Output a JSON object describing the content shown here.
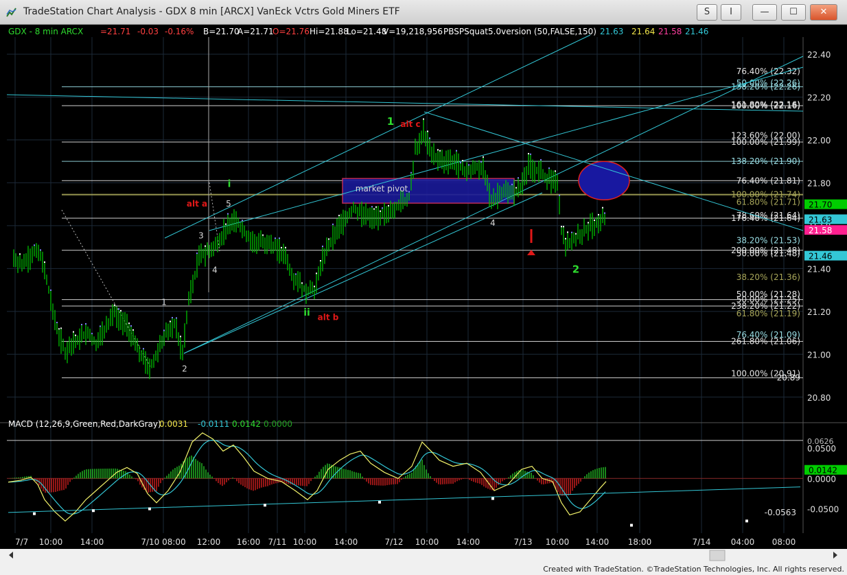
{
  "window": {
    "title": "TradeStation Chart Analysis - GDX 8 min [ARCX] VanEck Vctrs Gold Miners ETF",
    "btn_s": "S",
    "btn_i": "I",
    "btn_min": "—",
    "btn_max": "☐",
    "btn_close": "✕"
  },
  "footer": "Created with TradeStation. ©TradeStation Technologies, Inc. All rights reserved.",
  "colors": {
    "background": "#000000",
    "bars": "#00c000",
    "trendline": "#33c7d6",
    "grid": "#1c2a38",
    "fib_white": "#e6e6e6",
    "fib_cyan": "#9adfe6",
    "fib_olive": "#a9a75a",
    "wave_green": "#2edb2e",
    "wave_red": "#e01818",
    "wave_white": "#d8d8d8",
    "macd_line": "#f2f26a",
    "signal_line": "#33c7d6",
    "hist_pos": "#22b422",
    "hist_neg": "#c81e1e"
  },
  "chart_data": [
    {
      "type": "bar",
      "title": "GDX - 8 min ARCX",
      "ohlc": {
        "last": "=21.71",
        "change": "-0.03",
        "change_pct": "-0.16%",
        "bid": "B=21.70",
        "ask": "A=21.71",
        "open": "O=21.76",
        "high": "Hi=21.88",
        "low": "Lo=21.48",
        "volume": "V=19,218,956"
      },
      "study_label": "PBSPSquat5.0version (50,FALSE,150)",
      "study_values": [
        "21.63",
        "21.64",
        "21.58",
        "21.46"
      ],
      "ylim": [
        20.7,
        22.48
      ],
      "y_ticks": [
        "22.40",
        "22.20",
        "22.00",
        "21.80",
        "21.60",
        "21.40",
        "21.20",
        "21.00",
        "20.80"
      ],
      "price_markers": [
        {
          "label": "21.70",
          "value": 21.7,
          "bg": "#00cc00",
          "fg": "#000000"
        },
        {
          "label": "21.63",
          "value": 21.63,
          "bg": "#33c7d6",
          "fg": "#000000"
        },
        {
          "label": "21.58",
          "value": 21.58,
          "bg": "#ff1f8f",
          "fg": "#ffffff"
        },
        {
          "label": "21.46",
          "value": 21.46,
          "bg": "#33c7d6",
          "fg": "#000000"
        }
      ],
      "x_ticks": [
        "7/7",
        "10:00",
        "14:00",
        "7/10 08:00",
        "12:00",
        "16:00",
        "7/11",
        "10:00",
        "14:00",
        "7/12",
        "10:00",
        "14:00",
        "7/13",
        "10:00",
        "14:00",
        "18:00",
        "7/14",
        "04:00",
        "08:00"
      ],
      "price_path": [
        [
          20,
          21.45
        ],
        [
          35,
          21.42
        ],
        [
          55,
          21.5
        ],
        [
          68,
          21.35
        ],
        [
          80,
          21.15
        ],
        [
          95,
          21.0
        ],
        [
          110,
          21.05
        ],
        [
          125,
          21.1
        ],
        [
          140,
          21.05
        ],
        [
          155,
          21.12
        ],
        [
          165,
          21.2
        ],
        [
          180,
          21.15
        ],
        [
          200,
          21.05
        ],
        [
          215,
          20.93
        ],
        [
          230,
          21.0
        ],
        [
          240,
          21.1
        ],
        [
          255,
          21.15
        ],
        [
          265,
          20.99
        ],
        [
          275,
          21.25
        ],
        [
          290,
          21.45
        ],
        [
          310,
          21.5
        ],
        [
          320,
          21.52
        ],
        [
          330,
          21.6
        ],
        [
          345,
          21.62
        ],
        [
          360,
          21.55
        ],
        [
          375,
          21.52
        ],
        [
          395,
          21.52
        ],
        [
          415,
          21.45
        ],
        [
          430,
          21.35
        ],
        [
          445,
          21.3
        ],
        [
          460,
          21.3
        ],
        [
          470,
          21.45
        ],
        [
          485,
          21.55
        ],
        [
          500,
          21.62
        ],
        [
          515,
          21.68
        ],
        [
          530,
          21.65
        ],
        [
          545,
          21.63
        ],
        [
          560,
          21.66
        ],
        [
          580,
          21.7
        ],
        [
          595,
          21.72
        ],
        [
          605,
          21.95
        ],
        [
          618,
          22.05
        ],
        [
          625,
          21.95
        ],
        [
          640,
          21.9
        ],
        [
          660,
          21.9
        ],
        [
          680,
          21.85
        ],
        [
          700,
          21.88
        ],
        [
          710,
          21.82
        ],
        [
          715,
          21.7
        ],
        [
          730,
          21.76
        ],
        [
          745,
          21.74
        ],
        [
          760,
          21.78
        ],
        [
          770,
          21.88
        ],
        [
          785,
          21.85
        ],
        [
          800,
          21.82
        ],
        [
          812,
          21.78
        ],
        [
          818,
          21.58
        ],
        [
          825,
          21.5
        ],
        [
          840,
          21.55
        ],
        [
          855,
          21.58
        ],
        [
          870,
          21.62
        ],
        [
          883,
          21.64
        ]
      ],
      "fib_levels": [
        {
          "label": "76.40% (22.32)",
          "value": 22.32,
          "c": "white",
          "line": false
        },
        {
          "label": "50.00% (22.26)",
          "value": 22.265,
          "c": "cyan",
          "line": false
        },
        {
          "label": "138.20% (22.26)",
          "value": 22.248,
          "c": "cyan",
          "line": true
        },
        {
          "label": "161.80% (22.16)",
          "value": 22.165,
          "c": "white",
          "line": false
        },
        {
          "label": "100.00% (22.16)",
          "value": 22.16,
          "c": "white",
          "line": true
        },
        {
          "label": "123.60% (22.00)",
          "value": 22.02,
          "c": "white",
          "line": false
        },
        {
          "label": "100.00% (21.99)",
          "value": 21.99,
          "c": "white",
          "line": true
        },
        {
          "label": "138.20% (21.90)",
          "value": 21.9,
          "c": "cyan",
          "line": true
        },
        {
          "label": "76.40% (21.81)",
          "value": 21.81,
          "c": "white",
          "line": true
        },
        {
          "label": "100.00% (21.74)",
          "value": 21.745,
          "c": "olive",
          "line": true
        },
        {
          "label": "61.80% (21.71)",
          "value": 21.71,
          "c": "olive",
          "line": false
        },
        {
          "label": "78.60% (21.64)",
          "value": 21.648,
          "c": "white",
          "line": false
        },
        {
          "label": "176.40% (21.64)",
          "value": 21.635,
          "c": "white",
          "line": true
        },
        {
          "label": "38.20% (21.53)",
          "value": 21.53,
          "c": "cyan",
          "line": false
        },
        {
          "label": "200.00% (21.48)",
          "value": 21.485,
          "c": "white",
          "line": true
        },
        {
          "label": "50.00% (21.48)",
          "value": 21.47,
          "c": "white",
          "line": false
        },
        {
          "label": "38.20% (21.36)",
          "value": 21.36,
          "c": "olive",
          "line": false
        },
        {
          "label": "50.00% (21.28)",
          "value": 21.28,
          "c": "white",
          "line": false
        },
        {
          "label": "50.00% (21.25)",
          "value": 21.255,
          "c": "white",
          "line": true
        },
        {
          "label": "238.20% (21.22)",
          "value": 21.225,
          "c": "white",
          "line": true
        },
        {
          "label": "61.80% (21.19)",
          "value": 21.19,
          "c": "olive",
          "line": false
        },
        {
          "label": "76.40% (21.09)",
          "value": 21.09,
          "c": "cyan",
          "line": false
        },
        {
          "label": "261.80% (21.06)",
          "value": 21.06,
          "c": "white",
          "line": true
        },
        {
          "label": "100.00% (20.91)",
          "value": 20.91,
          "c": "white",
          "line": false
        },
        {
          "label": "20.89",
          "value": 20.89,
          "c": "white",
          "line": true
        }
      ],
      "annotations": [
        {
          "text": "1",
          "x": 569,
          "y": 22.07,
          "c": "green",
          "size": 15
        },
        {
          "text": "alt c",
          "x": 598,
          "y": 22.06,
          "c": "red",
          "size": 12
        },
        {
          "text": "i",
          "x": 334,
          "y": 21.78,
          "c": "green",
          "size": 14
        },
        {
          "text": "alt a",
          "x": 287,
          "y": 21.69,
          "c": "red",
          "size": 12
        },
        {
          "text": "5",
          "x": 333,
          "y": 21.69,
          "c": "white",
          "size": 12
        },
        {
          "text": "3",
          "x": 293,
          "y": 21.54,
          "c": "white",
          "size": 12
        },
        {
          "text": "4",
          "x": 313,
          "y": 21.38,
          "c": "white",
          "size": 12
        },
        {
          "text": "1",
          "x": 239,
          "y": 21.23,
          "c": "white",
          "size": 12
        },
        {
          "text": "2",
          "x": 269,
          "y": 20.92,
          "c": "white",
          "size": 12
        },
        {
          "text": "ii",
          "x": 447,
          "y": 21.18,
          "c": "green",
          "size": 14
        },
        {
          "text": "alt b",
          "x": 478,
          "y": 21.16,
          "c": "red",
          "size": 12
        },
        {
          "text": "4",
          "x": 718,
          "y": 21.6,
          "c": "white",
          "size": 12
        },
        {
          "text": "2",
          "x": 839,
          "y": 21.38,
          "c": "green",
          "size": 15
        },
        {
          "text": "market pivot",
          "x": 556,
          "y": 21.76,
          "c": "white",
          "size": 12
        }
      ]
    },
    {
      "type": "line",
      "title": "MACD (12,26,9,Green,Red,DarkGray)",
      "values": [
        "0.0031",
        "-0.0111",
        "0.0142",
        "0.0000"
      ],
      "ylim": [
        -0.09,
        0.085
      ],
      "y_ticks": [
        "0.0500",
        "0.0000",
        "-0.0500"
      ],
      "top_tick": "0.0626",
      "markers": [
        {
          "label": "0.0142",
          "value": 0.0142,
          "bg": "#00cc00",
          "fg": "#000000"
        }
      ],
      "trend_label": "-0.0563",
      "macd": [
        [
          12,
          -0.006
        ],
        [
          30,
          -0.003
        ],
        [
          45,
          0.002
        ],
        [
          55,
          -0.01
        ],
        [
          65,
          -0.035
        ],
        [
          80,
          -0.055
        ],
        [
          95,
          -0.07
        ],
        [
          110,
          -0.055
        ],
        [
          125,
          -0.035
        ],
        [
          140,
          -0.02
        ],
        [
          155,
          -0.005
        ],
        [
          170,
          0.01
        ],
        [
          185,
          0.018
        ],
        [
          200,
          0.008
        ],
        [
          215,
          -0.025
        ],
        [
          228,
          -0.04
        ],
        [
          245,
          -0.02
        ],
        [
          262,
          0.01
        ],
        [
          280,
          0.06
        ],
        [
          295,
          0.075
        ],
        [
          310,
          0.065
        ],
        [
          325,
          0.045
        ],
        [
          340,
          0.055
        ],
        [
          355,
          0.035
        ],
        [
          370,
          0.012
        ],
        [
          390,
          0.0
        ],
        [
          410,
          -0.005
        ],
        [
          430,
          -0.02
        ],
        [
          448,
          -0.035
        ],
        [
          462,
          -0.02
        ],
        [
          478,
          0.015
        ],
        [
          495,
          0.03
        ],
        [
          510,
          0.04
        ],
        [
          525,
          0.045
        ],
        [
          540,
          0.025
        ],
        [
          560,
          0.01
        ],
        [
          580,
          0.0
        ],
        [
          600,
          0.02
        ],
        [
          615,
          0.06
        ],
        [
          628,
          0.045
        ],
        [
          640,
          0.03
        ],
        [
          660,
          0.02
        ],
        [
          680,
          0.025
        ],
        [
          700,
          0.01
        ],
        [
          720,
          -0.02
        ],
        [
          740,
          -0.01
        ],
        [
          760,
          0.015
        ],
        [
          775,
          0.02
        ],
        [
          790,
          0.0
        ],
        [
          805,
          -0.005
        ],
        [
          818,
          -0.04
        ],
        [
          830,
          -0.06
        ],
        [
          845,
          -0.055
        ],
        [
          860,
          -0.035
        ],
        [
          875,
          -0.015
        ],
        [
          883,
          -0.005
        ]
      ]
    }
  ]
}
